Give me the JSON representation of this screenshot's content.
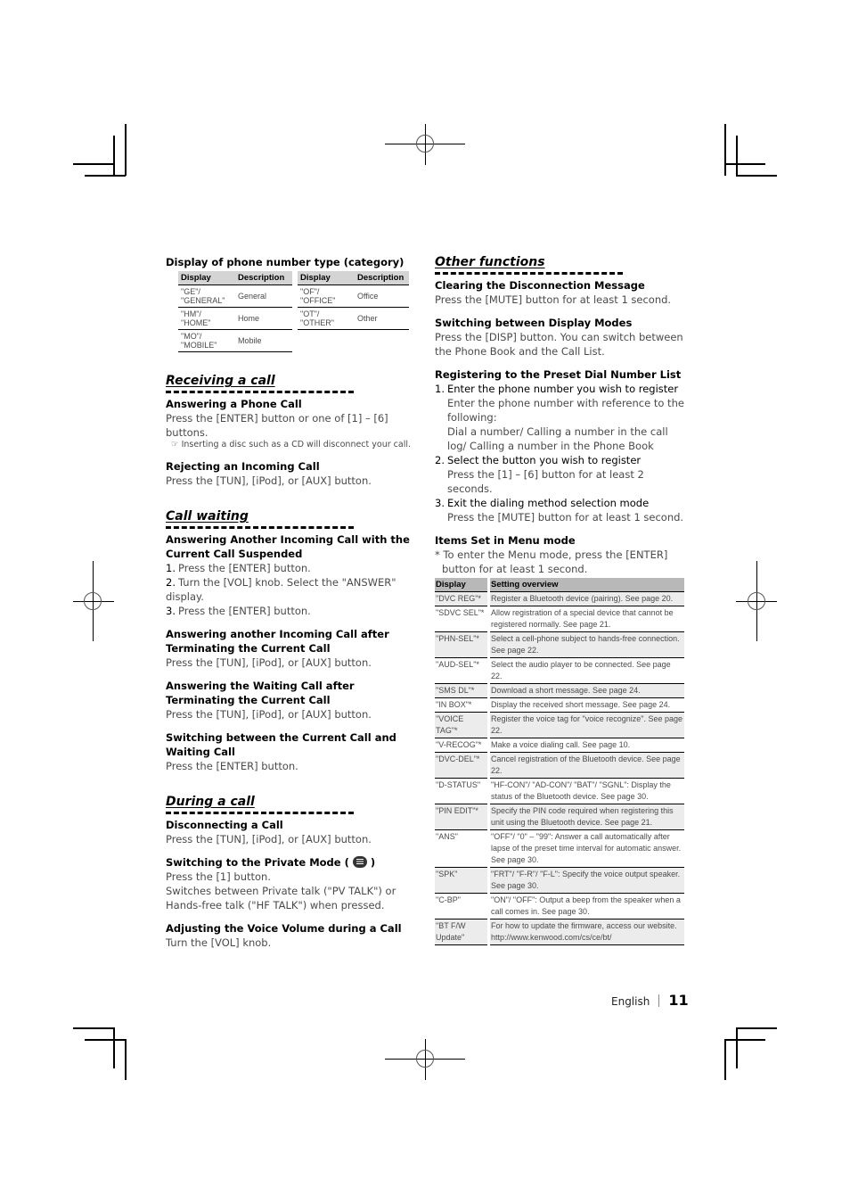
{
  "left": {
    "phone_type": {
      "heading": "Display of phone number type (category)",
      "headers": [
        "Display",
        "Description",
        "Display",
        "Description"
      ],
      "rows": [
        [
          "\"GE\"/ \"GENERAL\"",
          "General",
          "\"OF\"/ \"OFFICE\"",
          "Office"
        ],
        [
          "\"HM\"/ \"HOME\"",
          "Home",
          "\"OT\"/ \"OTHER\"",
          "Other"
        ],
        [
          "\"MO\"/ \"MOBILE\"",
          "Mobile",
          "",
          ""
        ]
      ]
    },
    "receiving": {
      "title": "Receiving a call",
      "answer_heading": "Answering a Phone Call",
      "answer_text": "Press the [ENTER] button or one of [1] – [6] buttons.",
      "answer_note": "Inserting a disc such as a CD will disconnect your call.",
      "note_icon": "☞",
      "reject_heading": "Rejecting an Incoming Call",
      "reject_text": "Press the [TUN], [iPod], or [AUX] button."
    },
    "waiting": {
      "title": "Call waiting",
      "suspend_heading": "Answering Another Incoming Call with the Current Call Suspended",
      "suspend_steps": [
        {
          "n": "1.",
          "t": "Press the [ENTER] button."
        },
        {
          "n": "2.",
          "t": "Turn the [VOL] knob. Select the \"ANSWER\" display."
        },
        {
          "n": "3.",
          "t": "Press the [ENTER] button."
        }
      ],
      "after_heading": "Answering another Incoming Call after Terminating the Current Call",
      "after_text": "Press the [TUN], [iPod], or [AUX] button.",
      "waiting_heading": "Answering the Waiting Call after Terminating the Current Call",
      "waiting_text": "Press the [TUN], [iPod], or [AUX] button.",
      "switch_heading": "Switching between the Current Call and Waiting Call",
      "switch_text": "Press the [ENTER] button."
    },
    "during": {
      "title": "During a call",
      "disc_heading": "Disconnecting a Call",
      "disc_text": "Press the [TUN], [iPod], or [AUX] button.",
      "private_heading_pre": "Switching to the Private Mode (",
      "private_heading_post": ")",
      "private_text1": "Press the [1] button.",
      "private_text2": "Switches between Private talk (\"PV TALK\") or Hands-free talk (\"HF TALK\") when pressed.",
      "volume_heading": "Adjusting the Voice Volume during a Call",
      "volume_text": "Turn the [VOL] knob."
    }
  },
  "right": {
    "other": {
      "title": "Other functions",
      "clear_heading": "Clearing the Disconnection Message",
      "clear_text": "Press the [MUTE] button for at least 1 second.",
      "display_heading": "Switching between Display Modes",
      "display_text": "Press the [DISP] button. You can switch between the Phone Book and the Call List.",
      "preset_heading": "Registering to the Preset Dial Number List",
      "preset_steps": [
        {
          "n": "1.",
          "t": "Enter the phone number you wish to register",
          "sub": [
            "Enter the phone number with reference to the following:",
            "Dial a number/ Calling a number in the call log/ Calling a number in the Phone Book"
          ]
        },
        {
          "n": "2.",
          "t": "Select the button you wish to register",
          "sub": [
            "Press the [1] – [6] button for at least 2 seconds."
          ]
        },
        {
          "n": "3.",
          "t": "Exit the dialing method selection mode",
          "sub": [
            "Press the [MUTE] button for at least 1 second."
          ]
        }
      ],
      "menu_heading": "Items Set in Menu mode",
      "menu_note": "* To enter the Menu mode, press the [ENTER] button for at least 1 second."
    },
    "menu_table": {
      "headers": [
        "Display",
        "Setting overview"
      ],
      "rows": [
        [
          "\"DVC REG\"*",
          "Register a Bluetooth device (pairing). See page 20."
        ],
        [
          "\"SDVC SEL\"*",
          "Allow registration of a special device that cannot be registered normally. See page 21."
        ],
        [
          "\"PHN-SEL\"*",
          "Select a cell-phone subject to hands-free connection. See page 22."
        ],
        [
          "\"AUD-SEL\"*",
          "Select the audio player to be connected. See page 22."
        ],
        [
          "\"SMS DL\"*",
          "Download a short message. See page 24."
        ],
        [
          "\"IN BOX\"*",
          "Display the received short message. See page 24."
        ],
        [
          "\"VOICE TAG\"*",
          "Register the voice tag for \"voice recognize\". See page 22."
        ],
        [
          "\"V-RECOG\"*",
          "Make a voice dialing call. See page 10."
        ],
        [
          "\"DVC-DEL\"*",
          "Cancel registration of the Bluetooth device. See page 22."
        ],
        [
          "\"D-STATUS\"",
          "\"HF-CON\"/ \"AD-CON\"/ \"BAT\"/ \"SGNL\": Display the status of the Bluetooth device. See page 30."
        ],
        [
          "\"PIN EDIT\"*",
          "Specify the PIN code required when registering this unit using the Bluetooth device. See page 21."
        ],
        [
          "\"ANS\"",
          "\"OFF\"/ \"0\" – \"99\": Answer a call automatically after lapse of the preset time interval for automatic answer. See page 30."
        ],
        [
          "\"SPK\"",
          "\"FRT\"/ \"F-R\"/ \"F-L\": Specify the voice output speaker. See page 30."
        ],
        [
          "\"C-BP\"",
          "\"ON\"/ \"OFF\": Output a beep from the speaker when a call comes in. See page 30."
        ],
        [
          "\"BT F/W Update\"",
          "For how to update the firmware, access our website. http://www.kenwood.com/cs/ce/bt/"
        ]
      ]
    }
  },
  "footer": {
    "language": "English",
    "page_number": "11"
  }
}
